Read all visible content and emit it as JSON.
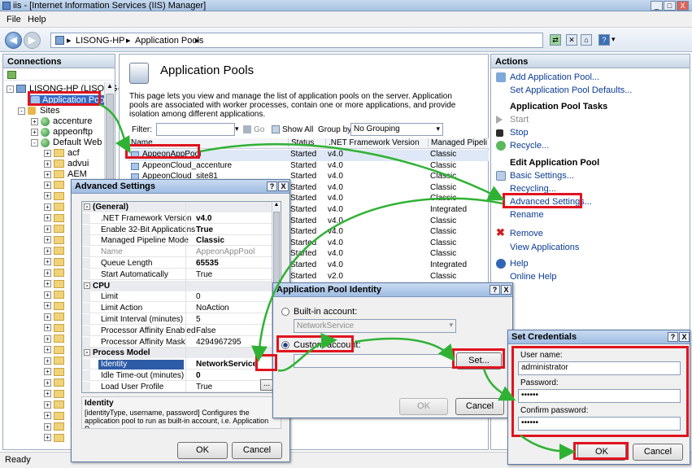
{
  "window": {
    "title": "iis - [Internet Information Services (IIS) Manager]",
    "minimize": "_",
    "maximize": "□",
    "close": "X"
  },
  "menu": [
    "File",
    "Help"
  ],
  "address": {
    "crumbs": [
      "LISONG-HP",
      "Application Pools"
    ],
    "separators": [
      "▸",
      "▸",
      "▸"
    ]
  },
  "connections": {
    "title": "Connections",
    "server": "LISONG-HP (LISONG-HP",
    "app_pools": "Application Pools",
    "sites": "Sites",
    "site_items": [
      "accenture",
      "appeonftp",
      "Default Web Sit"
    ],
    "folders": [
      "acf",
      "advui",
      "AEM"
    ]
  },
  "center": {
    "title": "Application Pools",
    "description": "This page lets you view and manage the list of application pools on the server. Application pools are associated with worker processes, contain one or more applications, and provide isolation among different applications.",
    "filter_label": "Filter:",
    "go": "Go",
    "show_all": "Show All",
    "group_by_label": "Group by:",
    "group_by_value": "No Grouping",
    "columns": [
      "Name",
      "Status",
      ".NET Framework Version",
      "Managed Pipeli"
    ],
    "rows": [
      [
        "AppeonAppPool",
        "Started",
        "v4.0",
        "Classic"
      ],
      [
        "AppeonCloud_accenture",
        "Started",
        "v4.0",
        "Classic"
      ],
      [
        "AppeonCloud_site81",
        "Started",
        "v4.0",
        "Classic"
      ],
      [
        "",
        "Started",
        "v4.0",
        "Classic"
      ],
      [
        "",
        "Started",
        "v4.0",
        "Classic"
      ],
      [
        "",
        "Started",
        "v4.0",
        "Integrated"
      ],
      [
        "",
        "Started",
        "v4.0",
        "Classic"
      ],
      [
        "",
        "Started",
        "v4.0",
        "Classic"
      ],
      [
        "",
        "Started",
        "v4.0",
        "Classic"
      ],
      [
        "",
        "Started",
        "v4.0",
        "Classic"
      ],
      [
        "",
        "Started",
        "v4.0",
        "Integrated"
      ],
      [
        "",
        "Started",
        "v2.0",
        "Classic"
      ]
    ]
  },
  "actions": {
    "title": "Actions",
    "top": [
      "Add Application Pool...",
      "Set Application Pool Defaults..."
    ],
    "tasks_title": "Application Pool Tasks",
    "tasks": [
      "Start",
      "Stop",
      "Recycle..."
    ],
    "edit_title": "Edit Application Pool",
    "edit": [
      "Basic Settings...",
      "Recycling...",
      "Advanced Settings...",
      "Rename"
    ],
    "remove": "Remove",
    "view_apps": "View Applications",
    "help": [
      "Help",
      "Online Help"
    ]
  },
  "status_bar": "Ready",
  "advanced": {
    "title": "Advanced Settings",
    "help": "?",
    "close": "X",
    "groups": [
      {
        "name": "(General)",
        "rows": [
          [
            ".NET Framework Version",
            "v4.0"
          ],
          [
            "Enable 32-Bit Applications",
            "True"
          ],
          [
            "Managed Pipeline Mode",
            "Classic"
          ],
          [
            "Name",
            "AppeonAppPool"
          ],
          [
            "Queue Length",
            "65535"
          ],
          [
            "Start Automatically",
            "True"
          ]
        ]
      },
      {
        "name": "CPU",
        "rows": [
          [
            "Limit",
            "0"
          ],
          [
            "Limit Action",
            "NoAction"
          ],
          [
            "Limit Interval (minutes)",
            "5"
          ],
          [
            "Processor Affinity Enabled",
            "False"
          ],
          [
            "Processor Affinity Mask",
            "4294967295"
          ]
        ]
      },
      {
        "name": "Process Model",
        "rows": [
          [
            "Identity",
            "NetworkService"
          ],
          [
            "Idle Time-out (minutes)",
            "0"
          ],
          [
            "Load User Profile",
            "True"
          ]
        ]
      }
    ],
    "ellipsis": "...",
    "desc_title": "Identity",
    "desc": "[identityType, username, password] Configures the application pool to run as built-in account, i.e. Application P...",
    "ok": "OK",
    "cancel": "Cancel"
  },
  "identity": {
    "title": "Application Pool Identity",
    "help": "?",
    "close": "X",
    "builtin_label": "Built-in account:",
    "builtin_value": "NetworkService",
    "custom_label": "Custom account:",
    "set": "Set...",
    "ok": "OK",
    "cancel": "Cancel"
  },
  "credentials": {
    "title": "Set Credentials",
    "help": "?",
    "close": "X",
    "user_label": "User name:",
    "user_value": "administrator",
    "pass_label": "Password:",
    "pass_value": "••••••",
    "confirm_label": "Confirm password:",
    "confirm_value": "••••••",
    "ok": "OK",
    "cancel": "Cancel"
  },
  "colors": {
    "highlight_red": "#e0141e",
    "arrow_green": "#2fb234",
    "link_blue": "#0b3c93"
  }
}
